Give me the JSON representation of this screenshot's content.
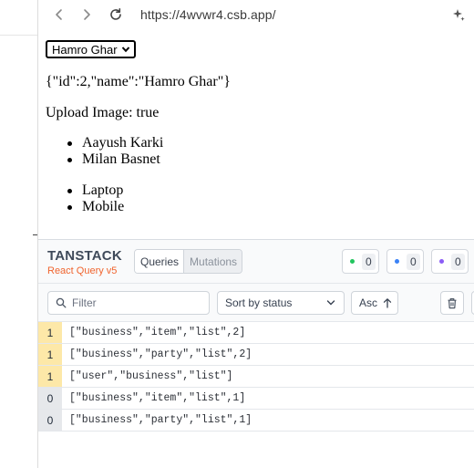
{
  "browser": {
    "url": "https://4wvwr4.csb.app/"
  },
  "app": {
    "select_value": "Hamro Ghar",
    "json_text": "{\"id\":2,\"name\":\"Hamro Ghar\"}",
    "upload_text": "Upload Image: true",
    "list1": [
      "Aayush Karki",
      "Milan Basnet"
    ],
    "list2": [
      "Laptop",
      "Mobile"
    ]
  },
  "devtools": {
    "logo_line1": "TANSTACK",
    "logo_line2": "React Query v5",
    "tabs": [
      "Queries",
      "Mutations"
    ],
    "counts": [
      {
        "color": "#22c55e",
        "value": "0"
      },
      {
        "color": "#3b82f6",
        "value": "0"
      },
      {
        "color": "#8b5cf6",
        "value": "0"
      }
    ],
    "filter_placeholder": "Filter",
    "sort_label": "Sort by status",
    "asc_label": "Asc",
    "queries": [
      {
        "count": "1",
        "key": "[\"business\",\"item\",\"list\",2]",
        "state": "fresh"
      },
      {
        "count": "1",
        "key": "[\"business\",\"party\",\"list\",2]",
        "state": "fresh"
      },
      {
        "count": "1",
        "key": "[\"user\",\"business\",\"list\"]",
        "state": "fresh"
      },
      {
        "count": "0",
        "key": "[\"business\",\"item\",\"list\",1]",
        "state": "inactive"
      },
      {
        "count": "0",
        "key": "[\"business\",\"party\",\"list\",1]",
        "state": "inactive"
      }
    ]
  }
}
